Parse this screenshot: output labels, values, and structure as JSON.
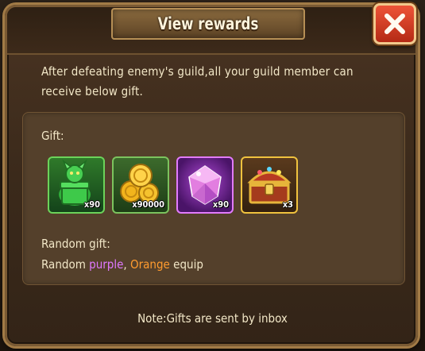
{
  "dialog": {
    "title": "View rewards",
    "close_icon": "close-x-icon",
    "description": "After defeating enemy's guild,all your guild member can receive below gift.",
    "gift_label": "Gift:",
    "items": [
      {
        "icon": "green-dragon-gift-icon",
        "count": "x90",
        "frame_color": "#6cd35a"
      },
      {
        "icon": "gold-coins-icon",
        "count": "x90000",
        "frame_color": "#7cc35e"
      },
      {
        "icon": "purple-gem-icon",
        "count": "x90",
        "frame_color": "#e27bff"
      },
      {
        "icon": "treasure-chest-icon",
        "count": "x3",
        "frame_color": "#f0c23e"
      }
    ],
    "random_label": "Random gift:",
    "random_prefix": "Random ",
    "random_purple": "purple",
    "random_sep": ", ",
    "random_orange": "Orange",
    "random_suffix": " equip",
    "note": "Note:Gifts are sent by inbox"
  },
  "colors": {
    "text": "#f2e7c7",
    "purple": "#e078ff",
    "orange": "#ff9b2e",
    "close_button": "#d43c22"
  }
}
